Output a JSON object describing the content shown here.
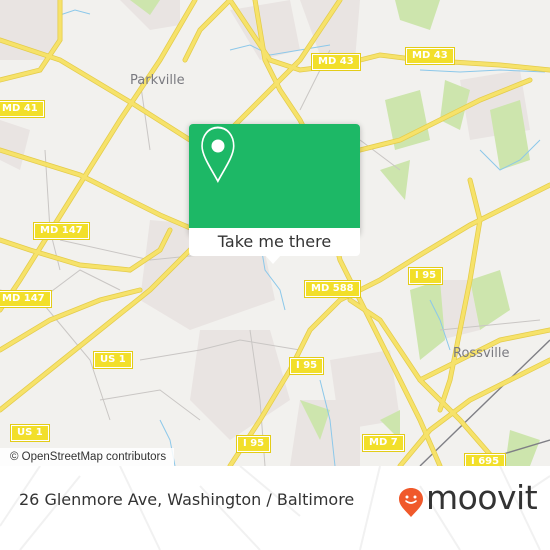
{
  "map": {
    "places": [
      {
        "name": "Parkville"
      },
      {
        "name": "Rossville"
      }
    ],
    "road_shields": [
      "MD 41",
      "MD 43",
      "MD 43",
      "MD 147",
      "MD 147",
      "MD 588",
      "I 95",
      "I 95",
      "I 95",
      "US 1",
      "US 1",
      "MD 7",
      "I 695"
    ],
    "attribution": "© OpenStreetMap contributors",
    "colors": {
      "background": "#f2f1ee",
      "road": "#f6e26a",
      "road_outline": "#e7cf4c",
      "park": "#cbe4a8",
      "water": "#8cc8ea",
      "urban": "#e8e2e0",
      "shield": "#f2df2a"
    }
  },
  "popup": {
    "icon": "map-pin-icon",
    "button_label": "Take me there",
    "color": "#1db866"
  },
  "footer": {
    "address": "26 Glenmore Ave, Washington / Baltimore",
    "brand": "moovit",
    "brand_color": "#f0592b"
  }
}
